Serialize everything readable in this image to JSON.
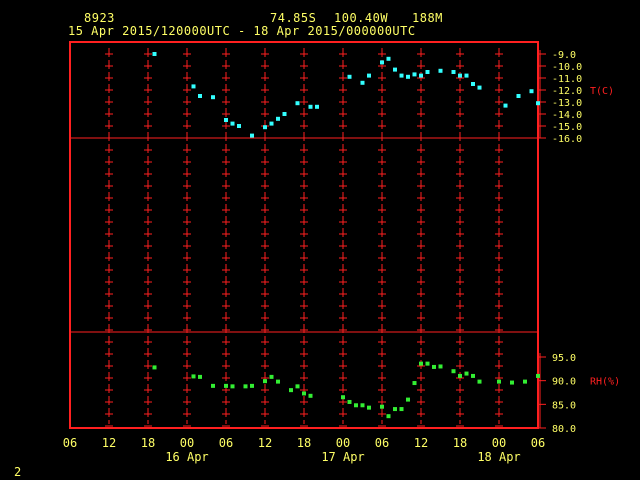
{
  "header": {
    "station_id": "8923",
    "latitude": "74.85S",
    "longitude": "100.40W",
    "elevation": "188M",
    "time_range": "15 Apr 2015/120000UTC - 18 Apr 2015/000000UTC"
  },
  "page_number": "2",
  "colors": {
    "frame": "#ff2020",
    "grid": "#ff2020",
    "temperature": "#33ffff",
    "humidity": "#33ee33",
    "text": "#ffff66"
  },
  "chart_data": [
    {
      "type": "scatter",
      "panel": "temperature",
      "unit_label": "T(C)",
      "ylim": [
        -16,
        -9
      ],
      "y_ticks": [
        "-9.0",
        "-10.0",
        "-11.0",
        "-12.0",
        "-13.0",
        "-14.0",
        "-15.0",
        "-16.0"
      ],
      "x_hours": [
        13,
        19,
        20,
        22,
        24,
        25,
        26,
        28,
        30,
        31,
        32,
        33,
        35,
        37,
        38,
        43,
        45,
        46,
        48,
        49,
        50,
        51,
        52,
        53,
        54,
        55,
        57,
        59,
        60,
        61,
        62,
        63,
        67,
        69,
        71,
        72
      ],
      "values": [
        -9.0,
        -11.7,
        -12.5,
        -12.6,
        -14.5,
        -14.8,
        -15.0,
        -15.8,
        -15.1,
        -14.8,
        -14.4,
        -14.0,
        -13.1,
        -13.4,
        -13.4,
        -10.9,
        -11.4,
        -10.8,
        -9.7,
        -9.4,
        -10.3,
        -10.8,
        -10.9,
        -10.7,
        -10.8,
        -10.5,
        -10.4,
        -10.5,
        -10.8,
        -10.8,
        -11.5,
        -11.8,
        -13.3,
        -12.5,
        -12.1,
        -13.1
      ]
    },
    {
      "type": "scatter",
      "panel": "relative_humidity",
      "unit_label": "RH(%)",
      "ylim": [
        80,
        95
      ],
      "y_ticks": [
        "95.0",
        "90.0",
        "85.0",
        "80.0"
      ],
      "x_hours": [
        13,
        19,
        20,
        22,
        24,
        25,
        27,
        28,
        30,
        31,
        32,
        34,
        35,
        36,
        37,
        42,
        43,
        44,
        45,
        46,
        48,
        49,
        50,
        51,
        52,
        53,
        54,
        55,
        56,
        57,
        59,
        60,
        61,
        62,
        63,
        66,
        68,
        70,
        72
      ],
      "values": [
        92.8,
        90.9,
        90.8,
        88.9,
        88.9,
        88.8,
        88.8,
        88.9,
        89.9,
        90.8,
        89.8,
        88.0,
        88.8,
        87.3,
        86.8,
        86.5,
        85.5,
        84.8,
        84.8,
        84.3,
        84.5,
        82.5,
        84.0,
        84.0,
        86.0,
        89.5,
        93.6,
        93.6,
        92.9,
        93.0,
        92.0,
        91.0,
        91.5,
        91.0,
        89.8,
        89.8,
        89.6,
        89.8,
        91.0
      ]
    }
  ],
  "x_axis": {
    "range_hours": [
      0,
      72
    ],
    "tick_hours": [
      0,
      6,
      12,
      18,
      24,
      30,
      36,
      42,
      48,
      54,
      60,
      66,
      72
    ],
    "tick_labels": [
      "06",
      "12",
      "18",
      "00",
      "06",
      "12",
      "18",
      "00",
      "06",
      "12",
      "18",
      "00",
      "06"
    ],
    "date_labels": [
      {
        "hour": 18,
        "text": "16 Apr"
      },
      {
        "hour": 42,
        "text": "17 Apr"
      },
      {
        "hour": 66,
        "text": "18 Apr"
      }
    ]
  }
}
